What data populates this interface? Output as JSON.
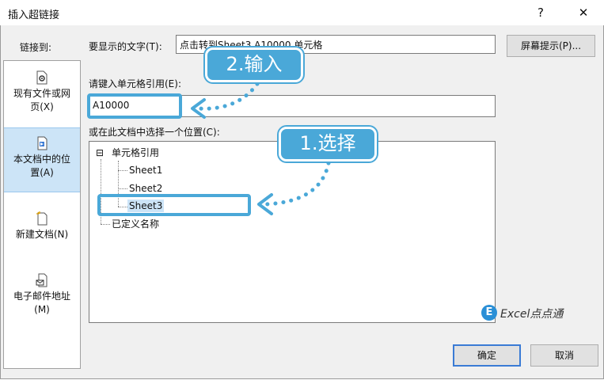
{
  "window": {
    "title": "插入超链接",
    "help_glyph": "?",
    "close_glyph": "✕"
  },
  "sidebar": {
    "label": "链接到:",
    "items": [
      {
        "label_line1": "现有文件或网",
        "label_line2": "页(X)",
        "icon": "existing-file-icon"
      },
      {
        "label_line1": "本文档中的位",
        "label_line2": "置(A)",
        "icon": "document-place-icon",
        "active": true
      },
      {
        "label_line1": "新建文档(N)",
        "label_line2": "",
        "icon": "new-document-icon"
      },
      {
        "label_line1": "电子邮件地址",
        "label_line2": "(M)",
        "icon": "email-address-icon"
      }
    ]
  },
  "form": {
    "display_text_label": "要显示的文字(T):",
    "display_text_value": "点击转到Sheet3 A10000 单元格",
    "screentip_button": "屏幕提示(P)...",
    "cell_ref_label": "请键入单元格引用(E):",
    "cell_ref_value": "A10000",
    "place_label": "或在此文档中选择一个位置(C):"
  },
  "tree": {
    "root": "单元格引用",
    "expander": "⊟",
    "children": [
      "Sheet1",
      "Sheet2",
      "Sheet3"
    ],
    "selected": "Sheet3",
    "defined_names": "已定义名称"
  },
  "buttons": {
    "ok": "确定",
    "cancel": "取消"
  },
  "annotations": {
    "step1": "1.选择",
    "step2": "2.输入"
  },
  "watermark": {
    "logo_letter": "E",
    "text": "Excel点点通"
  },
  "colors": {
    "accent": "#4aa8d8",
    "selection": "#cce4f7",
    "dialog_bg": "#f0f0f0"
  }
}
